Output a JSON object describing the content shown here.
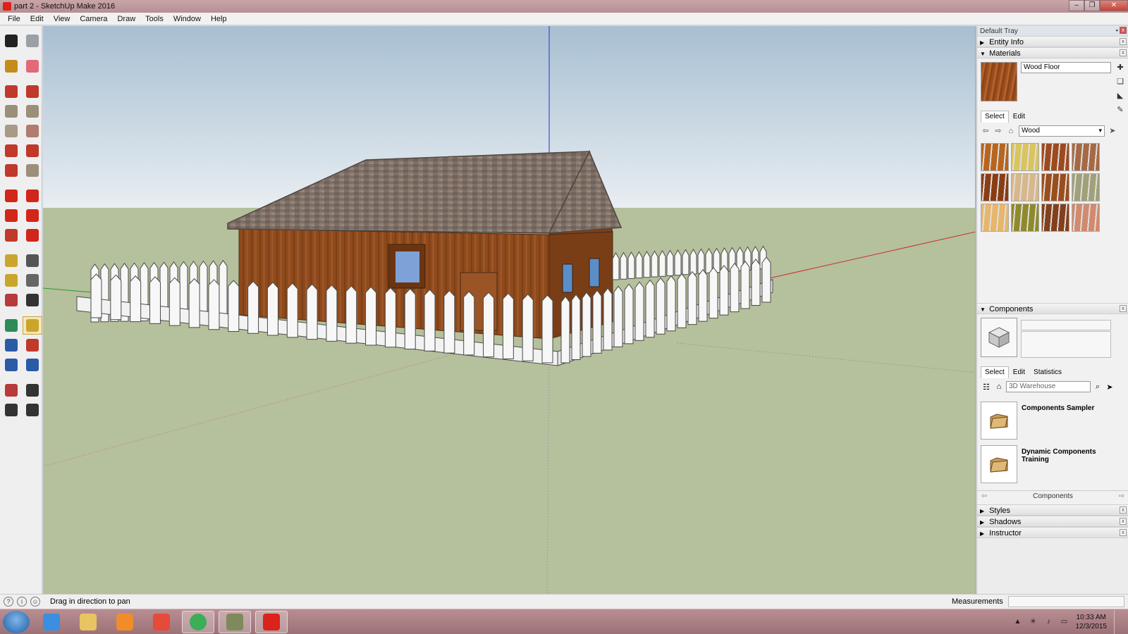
{
  "window": {
    "title": "part 2 - SketchUp Make 2016",
    "min_symbol": "–",
    "max_symbol": "❐",
    "close_symbol": "✕"
  },
  "menu": [
    "File",
    "Edit",
    "View",
    "Camera",
    "Draw",
    "Tools",
    "Window",
    "Help"
  ],
  "toolbar_left": {
    "tools": [
      {
        "name": "select-tool-icon",
        "color": "#222222"
      },
      {
        "name": "make-component-icon",
        "color": "#9aa0a6"
      },
      {
        "name": "paint-bucket-icon",
        "color": "#c58b1c"
      },
      {
        "name": "eraser-icon",
        "color": "#e2697a"
      },
      {
        "name": "pencil-line-icon",
        "color": "#c0392b"
      },
      {
        "name": "freehand-icon",
        "color": "#c0392b"
      },
      {
        "name": "rectangle-icon",
        "color": "#9c8f7a"
      },
      {
        "name": "rotated-rectangle-icon",
        "color": "#9c8f7a"
      },
      {
        "name": "circle-icon",
        "color": "#a89a86"
      },
      {
        "name": "polygon-icon",
        "color": "#b17c6d"
      },
      {
        "name": "arc-icon",
        "color": "#c0392b"
      },
      {
        "name": "two-point-arc-icon",
        "color": "#c0392b"
      },
      {
        "name": "three-point-arc-icon",
        "color": "#c0392b"
      },
      {
        "name": "pie-icon",
        "color": "#9c8f7a"
      },
      {
        "name": "move-icon",
        "color": "#d2261a"
      },
      {
        "name": "push-pull-icon",
        "color": "#d2261a"
      },
      {
        "name": "rotate-icon",
        "color": "#d2261a"
      },
      {
        "name": "follow-me-icon",
        "color": "#d2261a"
      },
      {
        "name": "scale-icon",
        "color": "#c0392b"
      },
      {
        "name": "offset-icon",
        "color": "#d2261a"
      },
      {
        "name": "tape-measure-icon",
        "color": "#c9a62b"
      },
      {
        "name": "dimension-icon",
        "color": "#555555"
      },
      {
        "name": "protractor-icon",
        "color": "#c9a62b"
      },
      {
        "name": "text-icon",
        "color": "#666666"
      },
      {
        "name": "axes-icon",
        "color": "#b83a3a"
      },
      {
        "name": "3d-text-icon",
        "color": "#333333"
      },
      {
        "name": "orbit-icon",
        "color": "#2e8b57"
      },
      {
        "name": "pan-icon",
        "color": "#c9a62b"
      },
      {
        "name": "zoom-icon",
        "color": "#2b5aa7"
      },
      {
        "name": "zoom-window-icon",
        "color": "#c0392b"
      },
      {
        "name": "zoom-extents-icon",
        "color": "#2b5aa7"
      },
      {
        "name": "previous-view-icon",
        "color": "#2b5aa7"
      },
      {
        "name": "position-camera-icon",
        "color": "#b83a3a"
      },
      {
        "name": "look-around-icon",
        "color": "#333333"
      },
      {
        "name": "walk-icon",
        "color": "#333333"
      },
      {
        "name": "section-plane-icon",
        "color": "#333333"
      }
    ]
  },
  "viewport": {
    "sky_top": "#a7bfd2",
    "sky_bottom": "#e9eef2",
    "ground": "#b5c09c"
  },
  "tray": {
    "title": "Default Tray",
    "pin_symbol": "▪",
    "close_symbol": "x",
    "entity_info": "Entity Info",
    "materials": {
      "header": "Materials",
      "name": "Wood Floor",
      "tabs": [
        "Select",
        "Edit"
      ],
      "collection": "Wood",
      "back_symbol": "⇦",
      "forward_symbol": "⇨",
      "home_symbol": "⌂",
      "details_symbol": "➤",
      "eyedropper_symbol": "✎",
      "create_symbol": "✚",
      "default_symbol": "❏",
      "swatches": [
        "#b7651f",
        "#d9c45f",
        "#9e4a1f",
        "#a56a45",
        "#8a3d15",
        "#d8b78a",
        "#9a4e1d",
        "#a0a07a",
        "#e7b66b",
        "#8e8a2c",
        "#83401c",
        "#d18a6e"
      ]
    },
    "components": {
      "header": "Components",
      "tabs": [
        "Select",
        "Edit",
        "Statistics"
      ],
      "search_placeholder": "3D Warehouse",
      "view_symbol": "☷",
      "home_symbol": "⌂",
      "search_symbol": "⌕",
      "details_symbol": "➤",
      "items": [
        "Components Sampler",
        "Dynamic Components Training"
      ],
      "footer": "Components",
      "footer_left": "⇦",
      "footer_right": "⇨"
    },
    "collapsed_panels": [
      "Styles",
      "Shadows",
      "Instructor"
    ]
  },
  "status": {
    "icons": [
      "?",
      "i",
      "☺"
    ],
    "message": "Drag in direction to pan",
    "measurements_label": "Measurements"
  },
  "taskbar": {
    "apps": [
      {
        "name": "internet-explorer-icon",
        "color": "#3a8fe0"
      },
      {
        "name": "file-explorer-icon",
        "color": "#e9c462"
      },
      {
        "name": "media-player-icon",
        "color": "#f08c2a"
      },
      {
        "name": "apps-grid-icon",
        "color": "#e64a3b"
      },
      {
        "name": "chrome-icon",
        "color": "#3bae57"
      },
      {
        "name": "game-icon",
        "color": "#7e8a5c"
      },
      {
        "name": "sketchup-icon",
        "color": "#d9231b"
      }
    ],
    "tray_icons": [
      "▲",
      "✳",
      "♪",
      "▭"
    ],
    "time": "10:33 AM",
    "date": "12/3/2015"
  }
}
